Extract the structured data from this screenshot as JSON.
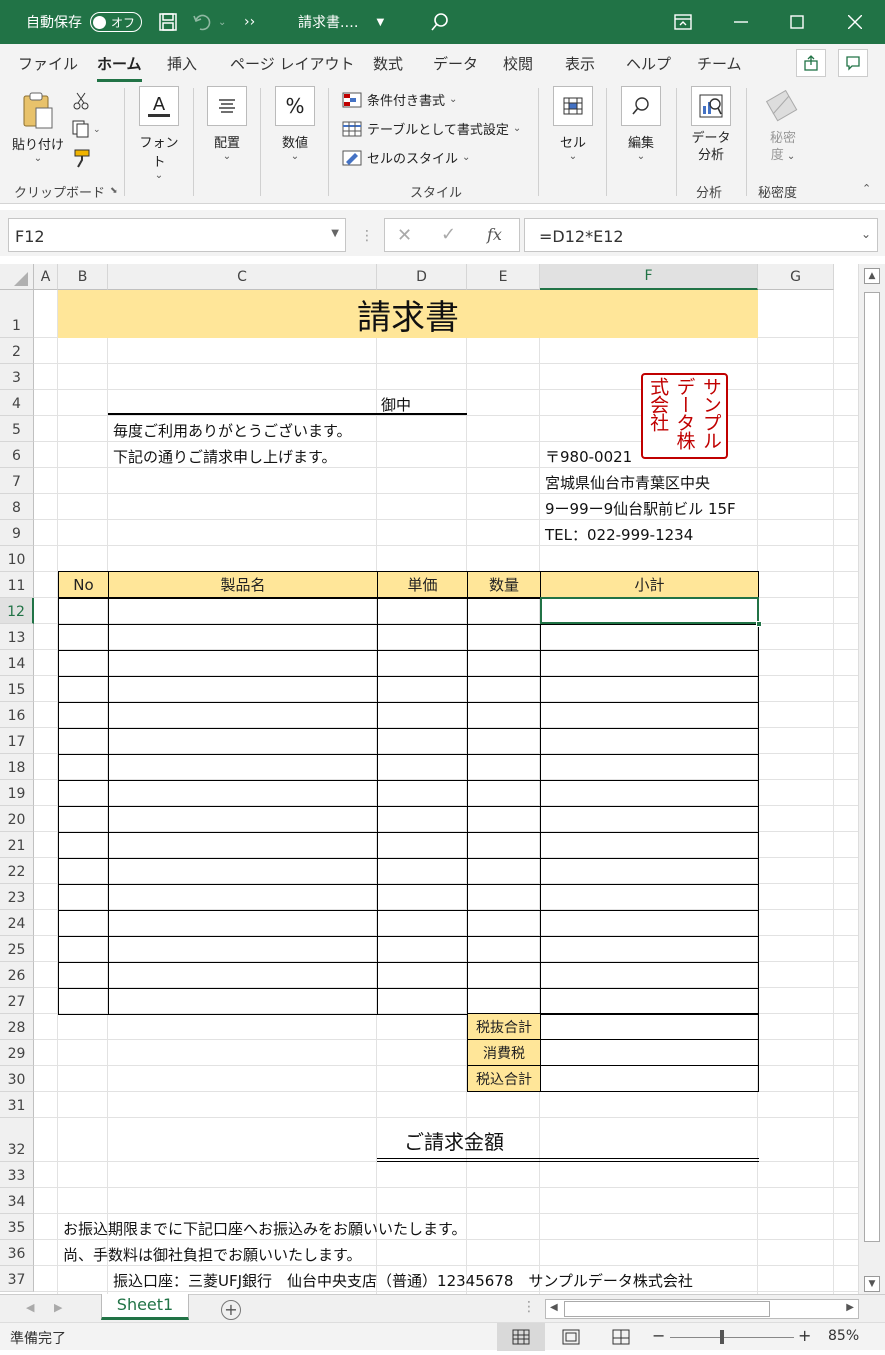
{
  "titlebar": {
    "autosave_label": "自動保存",
    "autosave_state": "オフ",
    "filename": "請求書.…",
    "more": "››"
  },
  "tabs": [
    "ファイル",
    "ホーム",
    "挿入",
    "ページ レイアウト",
    "数式",
    "データ",
    "校閲",
    "表示",
    "ヘルプ",
    "チーム"
  ],
  "ribbon": {
    "paste": "貼り付け",
    "clipboard_group": "クリップボード",
    "font": "フォント",
    "alignment": "配置",
    "number": "数値",
    "conditional": "条件付き書式",
    "as_table": "テーブルとして書式設定",
    "cell_styles": "セルのスタイル",
    "styles_group": "スタイル",
    "cells": "セル",
    "editing": "編集",
    "analyze_1": "データ",
    "analyze_2": "分析",
    "analyze_group": "分析",
    "sensitivity_1": "秘密",
    "sensitivity_2": "度",
    "sensitivity_group": "秘密度"
  },
  "formula_bar": {
    "name_box": "F12",
    "formula": "=D12*E12",
    "fx": "fx"
  },
  "columns": [
    "A",
    "B",
    "C",
    "D",
    "E",
    "F",
    "G"
  ],
  "rows": [
    "1",
    "2",
    "3",
    "4",
    "5",
    "6",
    "7",
    "8",
    "9",
    "10",
    "11",
    "12",
    "13",
    "14",
    "15",
    "16",
    "17",
    "18",
    "19",
    "20",
    "21",
    "22",
    "23",
    "24",
    "25",
    "26",
    "27",
    "28",
    "29",
    "30",
    "31",
    "32",
    "33",
    "34",
    "35",
    "36",
    "37"
  ],
  "invoice": {
    "title": "請求書",
    "onchu": "御中",
    "greeting1": "毎度ご利用ありがとうございます。",
    "greeting2": "下記の通りご請求申し上げます。",
    "postal": "〒980-0021",
    "address1": "宮城県仙台市青葉区中央",
    "address2": "9ー99ー9仙台駅前ビル 15F",
    "tel": "TEL：022-999-1234",
    "seal_col1": "サンプル",
    "seal_col2": "データ株",
    "seal_col3": "式会社",
    "headers": [
      "No",
      "製品名",
      "単価",
      "数量",
      "小計"
    ],
    "subtotal_label": "税抜合計",
    "tax_label": "消費税",
    "total_label": "税込合計",
    "amount_label": "ご請求金額",
    "note1": "お振込期限までに下記口座へお振込みをお願いいたします。",
    "note2": "尚、手数料は御社負担でお願いいたします。",
    "bank": "振込口座：三菱UFJ銀行　仙台中央支店（普通）12345678　サンプルデータ株式会社"
  },
  "sheet_tab": "Sheet1",
  "status": {
    "ready": "準備完了",
    "zoom": "85%"
  },
  "colors": {
    "excel_green": "#217346",
    "header_fill": "#ffe699",
    "seal_red": "#c00000"
  }
}
